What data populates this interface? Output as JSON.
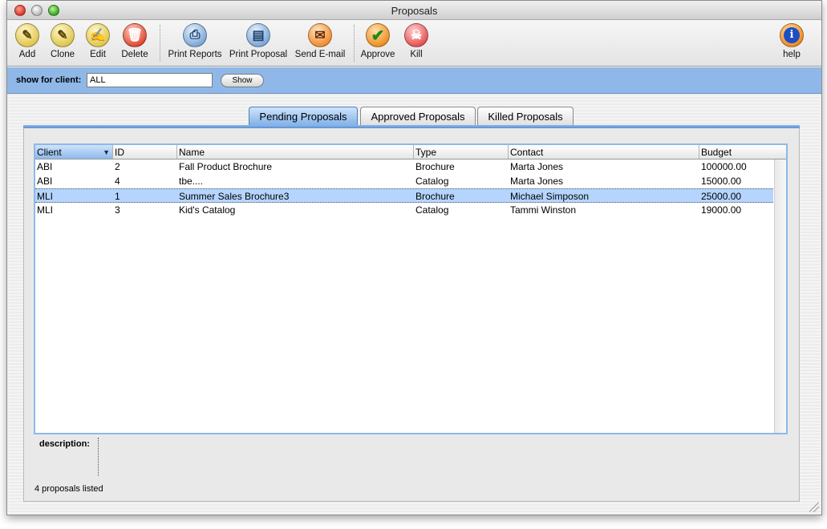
{
  "window": {
    "title": "Proposals"
  },
  "toolbar": {
    "items": [
      {
        "label": "Add",
        "icon": "pencil-icon",
        "glyph": "✎"
      },
      {
        "label": "Clone",
        "icon": "clone-pencil-icon",
        "glyph": "✎"
      },
      {
        "label": "Edit",
        "icon": "edit-hand-icon",
        "glyph": "✍"
      },
      {
        "label": "Delete",
        "icon": "trash-icon",
        "glyph": "🗑"
      },
      {
        "label": "Print Reports",
        "icon": "printer-icon",
        "glyph": "⎙"
      },
      {
        "label": "Print Proposal",
        "icon": "document-icon",
        "glyph": "▤"
      },
      {
        "label": "Send E-mail",
        "icon": "send-email-icon",
        "glyph": "✉"
      },
      {
        "label": "Approve",
        "icon": "checkmark-icon",
        "glyph": "✔"
      },
      {
        "label": "Kill",
        "icon": "skull-crossbones-icon",
        "glyph": "☠"
      },
      {
        "label": "help",
        "icon": "info-icon",
        "glyph": "i"
      }
    ]
  },
  "filter": {
    "label": "show for client:",
    "value": "ALL",
    "button_label": "Show"
  },
  "tabs": [
    {
      "label": "Pending Proposals",
      "active": true
    },
    {
      "label": "Approved Proposals",
      "active": false
    },
    {
      "label": "Killed Proposals",
      "active": false
    }
  ],
  "table": {
    "columns": [
      "Client",
      "ID",
      "Name",
      "Type",
      "Contact",
      "Budget"
    ],
    "sorted_column": "Client",
    "rows": [
      {
        "client": "ABI",
        "id": "2",
        "name": "Fall Product Brochure",
        "type": "Brochure",
        "contact": "Marta Jones",
        "budget": "100000.00",
        "selected": false
      },
      {
        "client": "ABI",
        "id": "4",
        "name": "tbe....",
        "type": "Catalog",
        "contact": "Marta Jones",
        "budget": "15000.00",
        "selected": false
      },
      {
        "client": "MLI",
        "id": "1",
        "name": "Summer Sales Brochure3",
        "type": "Brochure",
        "contact": "Michael Simposon",
        "budget": "25000.00",
        "selected": true
      },
      {
        "client": "MLI",
        "id": "3",
        "name": "Kid's Catalog",
        "type": "Catalog",
        "contact": "Tammi Winston",
        "budget": "19000.00",
        "selected": false
      }
    ]
  },
  "description": {
    "label": "description:",
    "value": ""
  },
  "status": {
    "text": "4 proposals listed"
  },
  "colors": {
    "accent": "#8fb8e8",
    "selection": "#b5d5ff"
  }
}
